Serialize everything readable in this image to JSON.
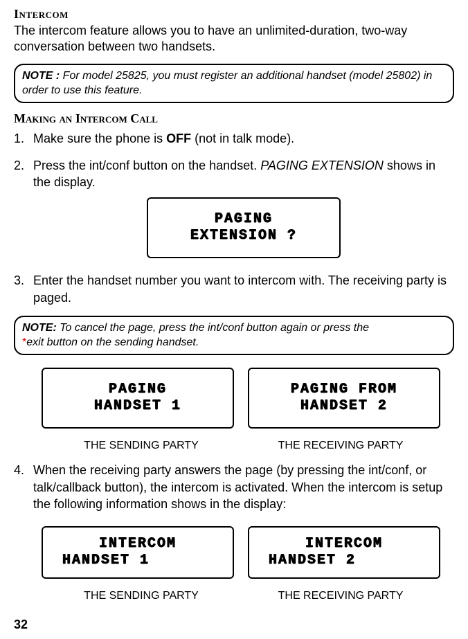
{
  "title_intercom": "Intercom",
  "intro": "The intercom feature allows you to have an unlimited-duration, two-way conversation between two handsets.",
  "note1_prefix": "NOTE :",
  "note1_body": " For model 25825, you must register an additional handset (model 25802) in order to use this feature.",
  "title_making_call": "Making an Intercom Call",
  "steps": {
    "s1_a": "Make sure the phone is ",
    "s1_off": "OFF",
    "s1_b": " (not in talk mode).",
    "s2_a": "Press the int/conf button on the handset. ",
    "s2_paging": "PAGING EXTENSION",
    "s2_b": " shows in the display.",
    "s3": "Enter the handset number you want to intercom with. The receiving party is paged.",
    "s4": "When the receiving party answers the page (by pressing the int/conf, or talk/callback button), the intercom is activated. When the intercom is setup the following information shows in the display:"
  },
  "note2_prefix": "NOTE:",
  "note2_body_a": " To cancel the page, press the int/conf button again or press the ",
  "note2_exit": "exit button on the sending handset.",
  "lcd": {
    "ext1": "PAGING",
    "ext2": "EXTENSION ?",
    "send1a": "PAGING",
    "send1b": "HANDSET 1",
    "recv1a": "PAGING FROM",
    "recv1b": "HANDSET 2",
    "intercom_a": "INTERCOM",
    "intercom_s": "HANDSET 1",
    "intercom_r": "HANDSET 2"
  },
  "labels": {
    "sending": "THE SENDING PARTY",
    "receiving": "THE RECEIVING PARTY"
  },
  "page_number": "32"
}
